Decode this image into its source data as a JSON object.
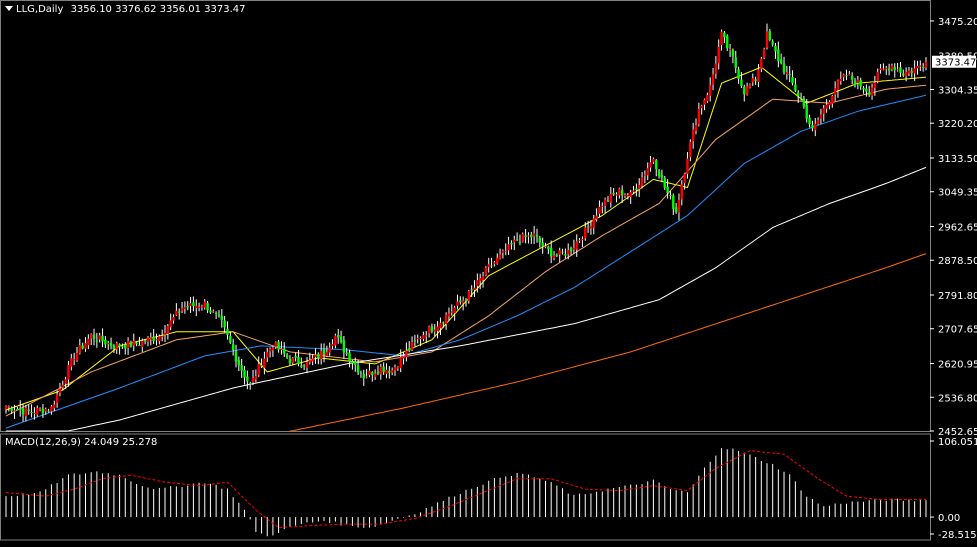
{
  "header": {
    "symbol": "LLG,Daily",
    "ohlc": "3356.10 3376.62 3356.01 3373.47"
  },
  "macd_header": {
    "label": "MACD(12,26,9)",
    "values": "24.049 25.278"
  },
  "current_price_label": "3373.47",
  "colors": {
    "background": "#000000",
    "bull": "#ff0000",
    "bear": "#00ff00",
    "wick": "#ffffff",
    "ma_fast": "#ffff00",
    "ma_mid": "#f4a460",
    "ma_slow": "#1e90ff",
    "ma_100": "#ffffff",
    "ma_200": "#ff6a00",
    "macd_hist": "#ffffff",
    "macd_signal": "#ff0000"
  },
  "chart_data": [
    {
      "type": "candlestick",
      "title": "LLG,Daily",
      "ylim": [
        2452.65,
        3510
      ],
      "y_tick_labels": [
        "3475.20",
        "3304.35",
        "3220.20",
        "3133.50",
        "3049.35",
        "2962.65",
        "2878.50",
        "2791.80",
        "2707.65",
        "2620.95",
        "2536.80",
        "2452.65"
      ],
      "y_ticks": [
        3475.2,
        3304.35,
        3220.2,
        3133.5,
        3049.35,
        2962.65,
        2878.5,
        2791.8,
        2707.65,
        2620.95,
        2536.8,
        2452.65
      ],
      "partially_hidden_tick": "3389.50",
      "last_price": 3373.47,
      "anchors": [
        [
          0,
          2515
        ],
        [
          8,
          2500
        ],
        [
          16,
          2510
        ],
        [
          24,
          2640
        ],
        [
          30,
          2690
        ],
        [
          38,
          2665
        ],
        [
          46,
          2670
        ],
        [
          54,
          2690
        ],
        [
          62,
          2760
        ],
        [
          70,
          2770
        ],
        [
          76,
          2720
        ],
        [
          82,
          2620
        ],
        [
          86,
          2565
        ],
        [
          90,
          2625
        ],
        [
          94,
          2670
        ],
        [
          100,
          2630
        ],
        [
          106,
          2620
        ],
        [
          112,
          2650
        ],
        [
          116,
          2690
        ],
        [
          120,
          2645
        ],
        [
          126,
          2590
        ],
        [
          132,
          2610
        ],
        [
          136,
          2605
        ],
        [
          140,
          2640
        ],
        [
          146,
          2690
        ],
        [
          152,
          2720
        ],
        [
          158,
          2760
        ],
        [
          164,
          2800
        ],
        [
          170,
          2860
        ],
        [
          176,
          2900
        ],
        [
          180,
          2930
        ],
        [
          186,
          2940
        ],
        [
          190,
          2905
        ],
        [
          194,
          2890
        ],
        [
          198,
          2900
        ],
        [
          204,
          2950
        ],
        [
          210,
          3020
        ],
        [
          216,
          3050
        ],
        [
          220,
          3040
        ],
        [
          224,
          3085
        ],
        [
          228,
          3135
        ],
        [
          232,
          3060
        ],
        [
          236,
          3000
        ],
        [
          240,
          3140
        ],
        [
          244,
          3255
        ],
        [
          248,
          3310
        ],
        [
          252,
          3440
        ],
        [
          256,
          3380
        ],
        [
          260,
          3300
        ],
        [
          264,
          3330
        ],
        [
          268,
          3440
        ],
        [
          272,
          3380
        ],
        [
          276,
          3330
        ],
        [
          280,
          3280
        ],
        [
          284,
          3200
        ],
        [
          288,
          3255
        ],
        [
          292,
          3310
        ],
        [
          296,
          3340
        ],
        [
          300,
          3320
        ],
        [
          304,
          3300
        ],
        [
          308,
          3350
        ],
        [
          312,
          3365
        ],
        [
          316,
          3345
        ],
        [
          320,
          3355
        ],
        [
          324,
          3373.47
        ]
      ],
      "ma_anchors": {
        "ma_fast": [
          [
            0,
            2505
          ],
          [
            20,
            2555
          ],
          [
            40,
            2665
          ],
          [
            60,
            2700
          ],
          [
            80,
            2700
          ],
          [
            92,
            2600
          ],
          [
            110,
            2635
          ],
          [
            130,
            2620
          ],
          [
            150,
            2680
          ],
          [
            170,
            2840
          ],
          [
            190,
            2915
          ],
          [
            210,
            2990
          ],
          [
            228,
            3080
          ],
          [
            240,
            3060
          ],
          [
            252,
            3320
          ],
          [
            266,
            3360
          ],
          [
            282,
            3270
          ],
          [
            300,
            3320
          ],
          [
            324,
            3335
          ]
        ],
        "ma_mid": [
          [
            0,
            2490
          ],
          [
            30,
            2600
          ],
          [
            60,
            2680
          ],
          [
            80,
            2700
          ],
          [
            100,
            2650
          ],
          [
            130,
            2625
          ],
          [
            150,
            2650
          ],
          [
            170,
            2740
          ],
          [
            190,
            2850
          ],
          [
            210,
            2940
          ],
          [
            230,
            3020
          ],
          [
            250,
            3180
          ],
          [
            270,
            3280
          ],
          [
            290,
            3270
          ],
          [
            310,
            3305
          ],
          [
            324,
            3315
          ]
        ],
        "ma_slow": [
          [
            0,
            2460
          ],
          [
            40,
            2560
          ],
          [
            70,
            2640
          ],
          [
            90,
            2665
          ],
          [
            120,
            2655
          ],
          [
            140,
            2640
          ],
          [
            160,
            2680
          ],
          [
            180,
            2740
          ],
          [
            200,
            2810
          ],
          [
            220,
            2900
          ],
          [
            240,
            2990
          ],
          [
            260,
            3120
          ],
          [
            280,
            3200
          ],
          [
            300,
            3250
          ],
          [
            324,
            3290
          ]
        ],
        "ma_100": [
          [
            0,
            2420
          ],
          [
            40,
            2480
          ],
          [
            80,
            2560
          ],
          [
            120,
            2620
          ],
          [
            160,
            2665
          ],
          [
            200,
            2720
          ],
          [
            230,
            2780
          ],
          [
            250,
            2860
          ],
          [
            270,
            2960
          ],
          [
            290,
            3020
          ],
          [
            310,
            3070
          ],
          [
            324,
            3110
          ]
        ],
        "ma_200": [
          [
            100,
            2452
          ],
          [
            140,
            2510
          ],
          [
            180,
            2575
          ],
          [
            220,
            2650
          ],
          [
            250,
            2720
          ],
          [
            280,
            2790
          ],
          [
            310,
            2860
          ],
          [
            324,
            2895
          ]
        ]
      }
    },
    {
      "type": "bar",
      "title": "MACD(12,26,9)",
      "y_tick_labels": [
        "106.051",
        "0.00",
        "-28.515"
      ],
      "y_ticks": [
        106.051,
        0,
        -28.515
      ],
      "ylim": [
        -28.515,
        106.051
      ],
      "macd_value": 24.049,
      "signal_value": 25.278,
      "hist_anchors": [
        [
          0,
          30
        ],
        [
          12,
          35
        ],
        [
          22,
          60
        ],
        [
          32,
          65
        ],
        [
          40,
          60
        ],
        [
          48,
          45
        ],
        [
          54,
          40
        ],
        [
          62,
          45
        ],
        [
          70,
          50
        ],
        [
          78,
          40
        ],
        [
          84,
          10
        ],
        [
          88,
          -20
        ],
        [
          92,
          -28
        ],
        [
          98,
          -18
        ],
        [
          104,
          -10
        ],
        [
          112,
          -5
        ],
        [
          120,
          -12
        ],
        [
          128,
          -15
        ],
        [
          136,
          -5
        ],
        [
          144,
          5
        ],
        [
          152,
          20
        ],
        [
          160,
          35
        ],
        [
          168,
          48
        ],
        [
          176,
          60
        ],
        [
          182,
          62
        ],
        [
          188,
          55
        ],
        [
          194,
          45
        ],
        [
          200,
          30
        ],
        [
          206,
          35
        ],
        [
          212,
          40
        ],
        [
          220,
          45
        ],
        [
          228,
          52
        ],
        [
          234,
          40
        ],
        [
          240,
          35
        ],
        [
          246,
          70
        ],
        [
          252,
          100
        ],
        [
          258,
          95
        ],
        [
          264,
          85
        ],
        [
          270,
          75
        ],
        [
          276,
          60
        ],
        [
          282,
          30
        ],
        [
          288,
          15
        ],
        [
          294,
          20
        ],
        [
          300,
          22
        ],
        [
          310,
          25
        ],
        [
          318,
          24
        ],
        [
          324,
          24.049
        ]
      ],
      "signal_anchors": [
        [
          0,
          35
        ],
        [
          14,
          30
        ],
        [
          24,
          40
        ],
        [
          34,
          55
        ],
        [
          44,
          60
        ],
        [
          56,
          50
        ],
        [
          68,
          45
        ],
        [
          78,
          50
        ],
        [
          88,
          10
        ],
        [
          96,
          -15
        ],
        [
          108,
          -12
        ],
        [
          120,
          -10
        ],
        [
          132,
          -10
        ],
        [
          144,
          -2
        ],
        [
          156,
          15
        ],
        [
          168,
          35
        ],
        [
          180,
          55
        ],
        [
          192,
          55
        ],
        [
          204,
          40
        ],
        [
          216,
          38
        ],
        [
          228,
          45
        ],
        [
          240,
          38
        ],
        [
          250,
          70
        ],
        [
          262,
          95
        ],
        [
          274,
          90
        ],
        [
          286,
          55
        ],
        [
          296,
          30
        ],
        [
          308,
          25
        ],
        [
          324,
          25.278
        ]
      ]
    }
  ]
}
